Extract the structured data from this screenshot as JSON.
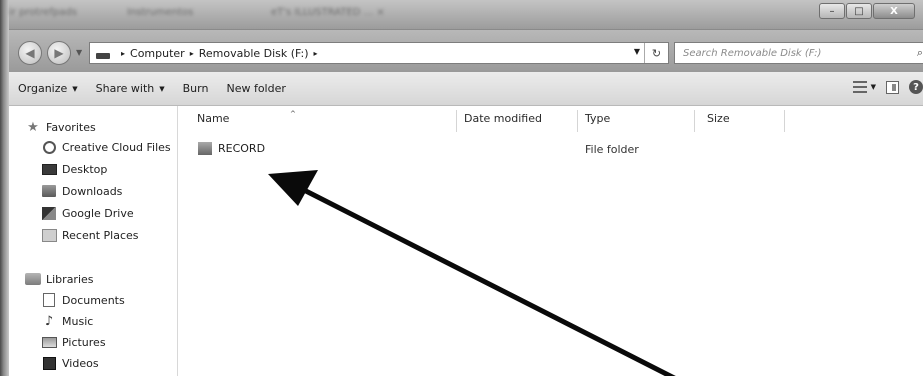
{
  "window": {
    "background_tabs": [
      "ir protrefpads",
      "Instrumentos",
      "eT's ILLUSTRATED ... ×"
    ],
    "minimize_glyph": "–",
    "maximize_glyph": "□",
    "close_glyph": "X"
  },
  "address": {
    "back_glyph": "◀",
    "forward_glyph": "▶",
    "breadcrumbs": [
      "Computer",
      "Removable Disk (F:)"
    ],
    "separator": "▸",
    "search_placeholder": "Search Removable Disk (F:)",
    "refresh_glyph": "↻",
    "search_glyph": "⌕"
  },
  "toolbar": {
    "organize": "Organize",
    "share_with": "Share with",
    "burn": "Burn",
    "new_folder": "New folder",
    "dropdown_glyph": "▼",
    "help_glyph": "?"
  },
  "navigation": {
    "favorites_header": "Favorites",
    "favorites": [
      "Creative Cloud Files",
      "Desktop",
      "Downloads",
      "Google Drive",
      "Recent Places"
    ],
    "libraries_header": "Libraries",
    "libraries": [
      "Documents",
      "Music",
      "Pictures",
      "Videos"
    ],
    "star_glyph": "★",
    "music_glyph": "♪"
  },
  "file_list": {
    "columns": [
      "Name",
      "Date modified",
      "Type",
      "Size"
    ],
    "sort_glyph": "^",
    "rows": [
      {
        "name": "RECORD",
        "date_modified": "",
        "type": "File folder",
        "size": ""
      }
    ]
  },
  "colors": {
    "titlebar": "#9c9c9c",
    "toolbar": "#e0e0e0",
    "annotation_arrow": "#0a0a0a"
  }
}
